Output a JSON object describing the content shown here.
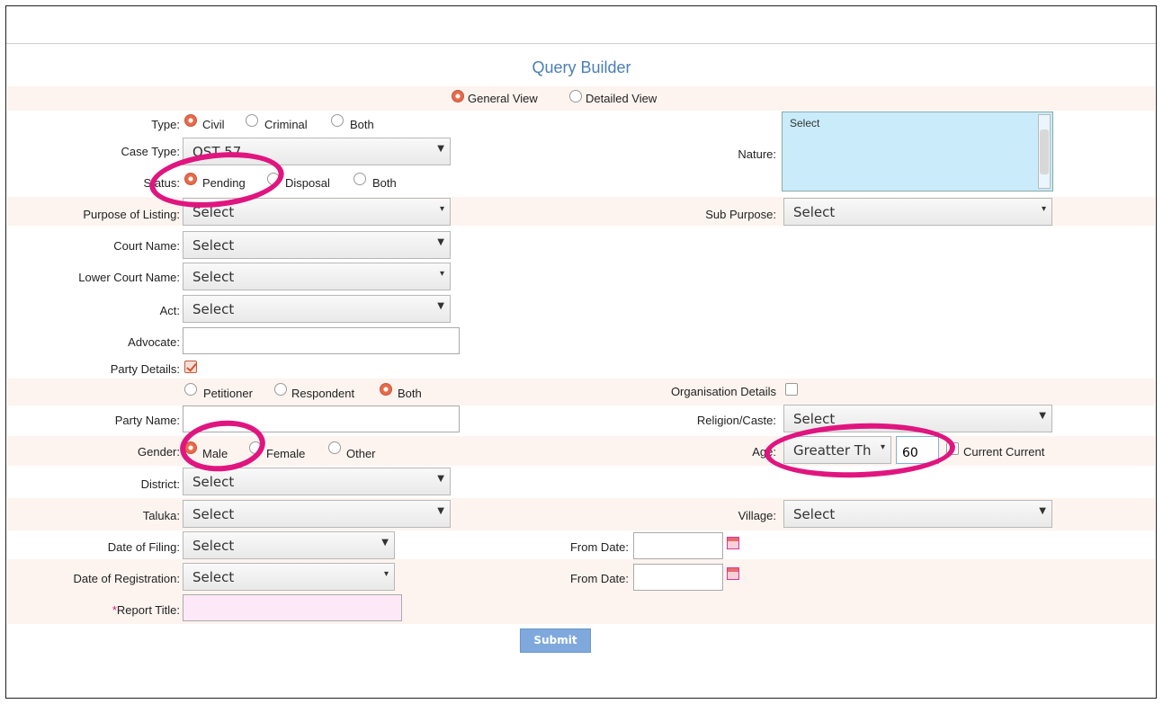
{
  "title": "Query Builder",
  "view_options": {
    "general": "General View",
    "detailed": "Detailed View"
  },
  "type": {
    "label": "Type:",
    "options": [
      "Civil",
      "Criminal",
      "Both"
    ],
    "selected": "Civil"
  },
  "case_type": {
    "label": "Case Type:",
    "value": "OST 57"
  },
  "status": {
    "label": "Status:",
    "options": [
      "Pending",
      "Disposal",
      "Both"
    ],
    "selected": "Pending"
  },
  "purpose": {
    "label": "Purpose of Listing:",
    "value": "Select"
  },
  "court_name": {
    "label": "Court Name:",
    "value": "Select"
  },
  "lower_court": {
    "label": "Lower Court Name:",
    "value": "Select"
  },
  "act": {
    "label": "Act:",
    "value": "Select"
  },
  "advocate": {
    "label": "Advocate:",
    "value": ""
  },
  "party_details": {
    "label": "Party Details:",
    "checked": true
  },
  "party_side": {
    "options": [
      "Petitioner",
      "Respondent",
      "Both"
    ],
    "selected": "Both"
  },
  "party_name": {
    "label": "Party Name:",
    "value": ""
  },
  "gender": {
    "label": "Gender:",
    "options": [
      "Male",
      "Female",
      "Other"
    ],
    "selected": "Male"
  },
  "district": {
    "label": "District:",
    "value": "Select"
  },
  "taluka": {
    "label": "Taluka:",
    "value": "Select"
  },
  "date_filing": {
    "label": "Date of Filing:",
    "value": "Select"
  },
  "date_registration": {
    "label": "Date of Registration:",
    "value": "Select"
  },
  "report_title": {
    "label": "Report Title:",
    "required_mark": "*",
    "value": ""
  },
  "nature": {
    "label": "Nature:",
    "value": "Select"
  },
  "sub_purpose": {
    "label": "Sub Purpose:",
    "value": "Select"
  },
  "organisation": {
    "label": "Organisation Details",
    "checked": false
  },
  "religion": {
    "label": "Religion/Caste:",
    "value": "Select"
  },
  "age": {
    "label": "Age:",
    "operator": "Greatter Th",
    "value": "60",
    "current_label": "Current Current"
  },
  "village": {
    "label": "Village:",
    "value": "Select"
  },
  "from_date_1": {
    "label": "From Date:",
    "value": ""
  },
  "from_date_2": {
    "label": "From Date:",
    "value": ""
  },
  "submit_label": "Submit",
  "colors": {
    "accent": "#4a7fb5",
    "radio_on": "#e86a4a",
    "highlight": "#e0157f",
    "nature_bg": "#c9ebfa"
  }
}
